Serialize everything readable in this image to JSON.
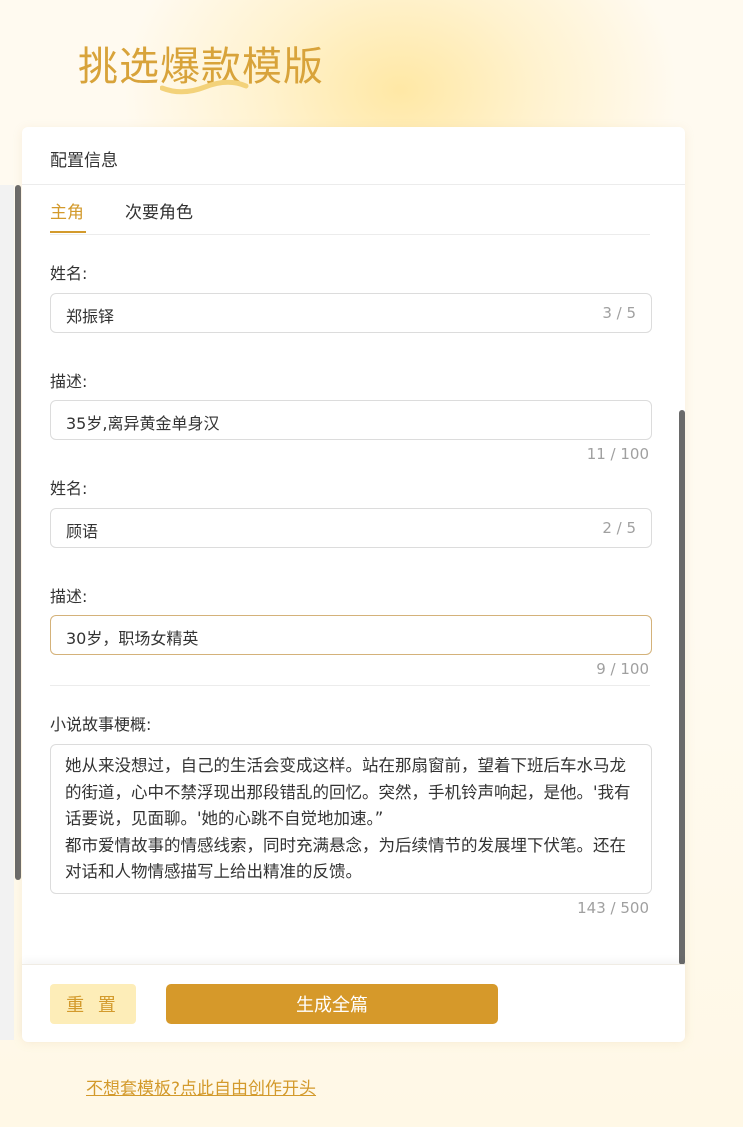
{
  "page": {
    "title": "挑选爆款模版",
    "bottom_link": "不想套模板?点此自由创作开头"
  },
  "card": {
    "header_title": "配置信息",
    "tabs": [
      {
        "label": "主角",
        "active": true
      },
      {
        "label": "次要角色",
        "active": false
      }
    ],
    "characters": [
      {
        "name_label": "姓名:",
        "name_value": "郑振铎",
        "name_count": "3 / 5",
        "desc_label": "描述:",
        "desc_value": "35岁,离异黄金单身汉",
        "desc_count": "11 / 100"
      },
      {
        "name_label": "姓名:",
        "name_value": "顾语",
        "name_count": "2 / 5",
        "desc_label": "描述:",
        "desc_value": "30岁，职场女精英",
        "desc_count": "9 / 100"
      }
    ],
    "synopsis": {
      "label": "小说故事梗概:",
      "value": "她从来没想过，自己的生活会变成这样。站在那扇窗前，望着下班后车水马龙的街道，心中不禁浮现出那段错乱的回忆。突然，手机铃声响起，是他。'我有话要说，见面聊。'她的心跳不自觉地加速。”\n都市爱情故事的情感线索，同时充满悬念，为后续情节的发展埋下伏笔。还在对话和人物情感描写上给出精准的反馈。",
      "count": "143 / 500"
    },
    "footer": {
      "reset_label": "重 置",
      "generate_label": "生成全篇"
    }
  },
  "colors": {
    "accent": "#d39a2c",
    "title": "#d8a33a",
    "reset_bg": "#fdedb8",
    "generate_bg": "#d6992a"
  }
}
